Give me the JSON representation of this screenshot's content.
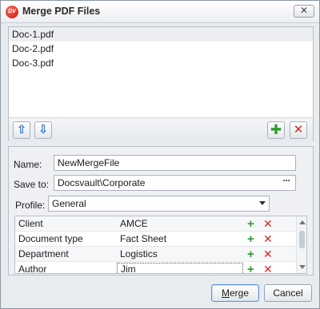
{
  "window": {
    "title": "Merge PDF Files",
    "logo_text": "DV"
  },
  "files": [
    {
      "name": "Doc-1.pdf",
      "selected": true
    },
    {
      "name": "Doc-2.pdf",
      "selected": false
    },
    {
      "name": "Doc-3.pdf",
      "selected": false
    }
  ],
  "toolbar": {
    "move_up_icon": "arrow-up-icon",
    "move_down_icon": "arrow-down-icon",
    "add_icon": "plus-icon",
    "remove_icon": "close-icon"
  },
  "form": {
    "name_label": "Name:",
    "name_value": "NewMergeFile",
    "save_to_label": "Save to:",
    "save_to_value": "Docsvault\\Corporate",
    "browse_label": "···",
    "profile_label": "Profile:",
    "profile_value": "General"
  },
  "metadata": [
    {
      "key": "Client",
      "value": "AMCE"
    },
    {
      "key": "Document type",
      "value": "Fact Sheet"
    },
    {
      "key": "Department",
      "value": "Logistics"
    },
    {
      "key": "Author",
      "value": "Jim"
    }
  ],
  "buttons": {
    "merge_prefix": "",
    "merge_mnemonic": "M",
    "merge_rest": "erge",
    "cancel": "Cancel"
  },
  "colors": {
    "accent_add": "#2f9a2f",
    "accent_remove": "#d12b22",
    "accent_arrow": "#2a6fd1"
  }
}
